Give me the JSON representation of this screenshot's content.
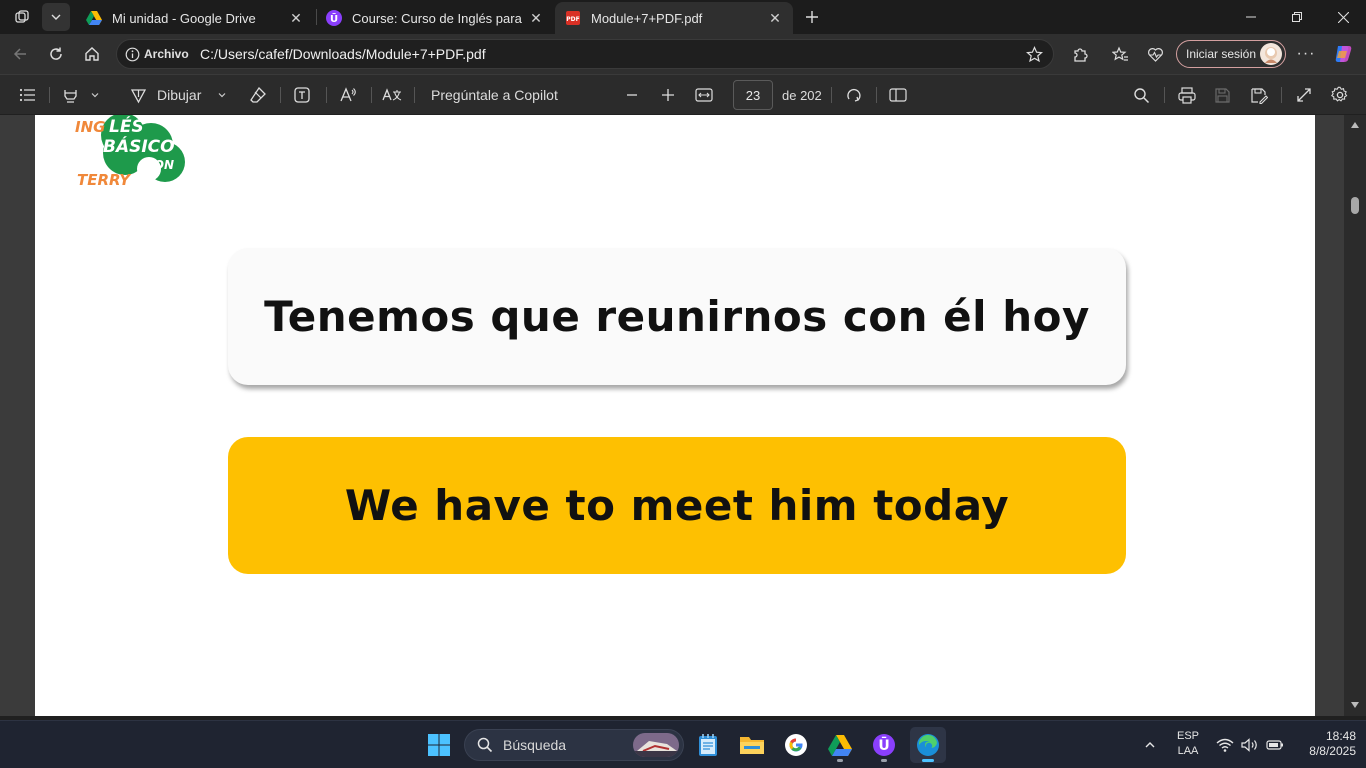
{
  "tabs": [
    {
      "title": "Mi unidad - Google Drive",
      "active": false
    },
    {
      "title": "Course: Curso de Inglés para principiantes",
      "active": false
    },
    {
      "title": "Module+7+PDF.pdf",
      "active": true
    }
  ],
  "address": {
    "badge": "Archivo",
    "url": "C:/Users/cafef/Downloads/Module+7+PDF.pdf"
  },
  "profile": {
    "signin_label": "Iniciar sesión"
  },
  "pdf_toolbar": {
    "draw_label": "Dibujar",
    "copilot_label": "Pregúntale a Copilot",
    "page_current": "23",
    "page_total": "de 202"
  },
  "document": {
    "logo": {
      "line1": "INGLÉS",
      "line2": "BÁSICO",
      "line3": "CON",
      "line4": "TERRY"
    },
    "spanish_phrase": "Tenemos que reunirnos con él hoy",
    "english_phrase": "We have to meet him today"
  },
  "taskbar": {
    "search_label": "Búsqueda",
    "lang_top": "ESP",
    "lang_bottom": "LAA",
    "time": "18:48",
    "date": "8/8/2025"
  },
  "colors": {
    "highlight_card": "#fec001",
    "logo_green": "#1e9a4b",
    "logo_orange": "#f0883a"
  }
}
